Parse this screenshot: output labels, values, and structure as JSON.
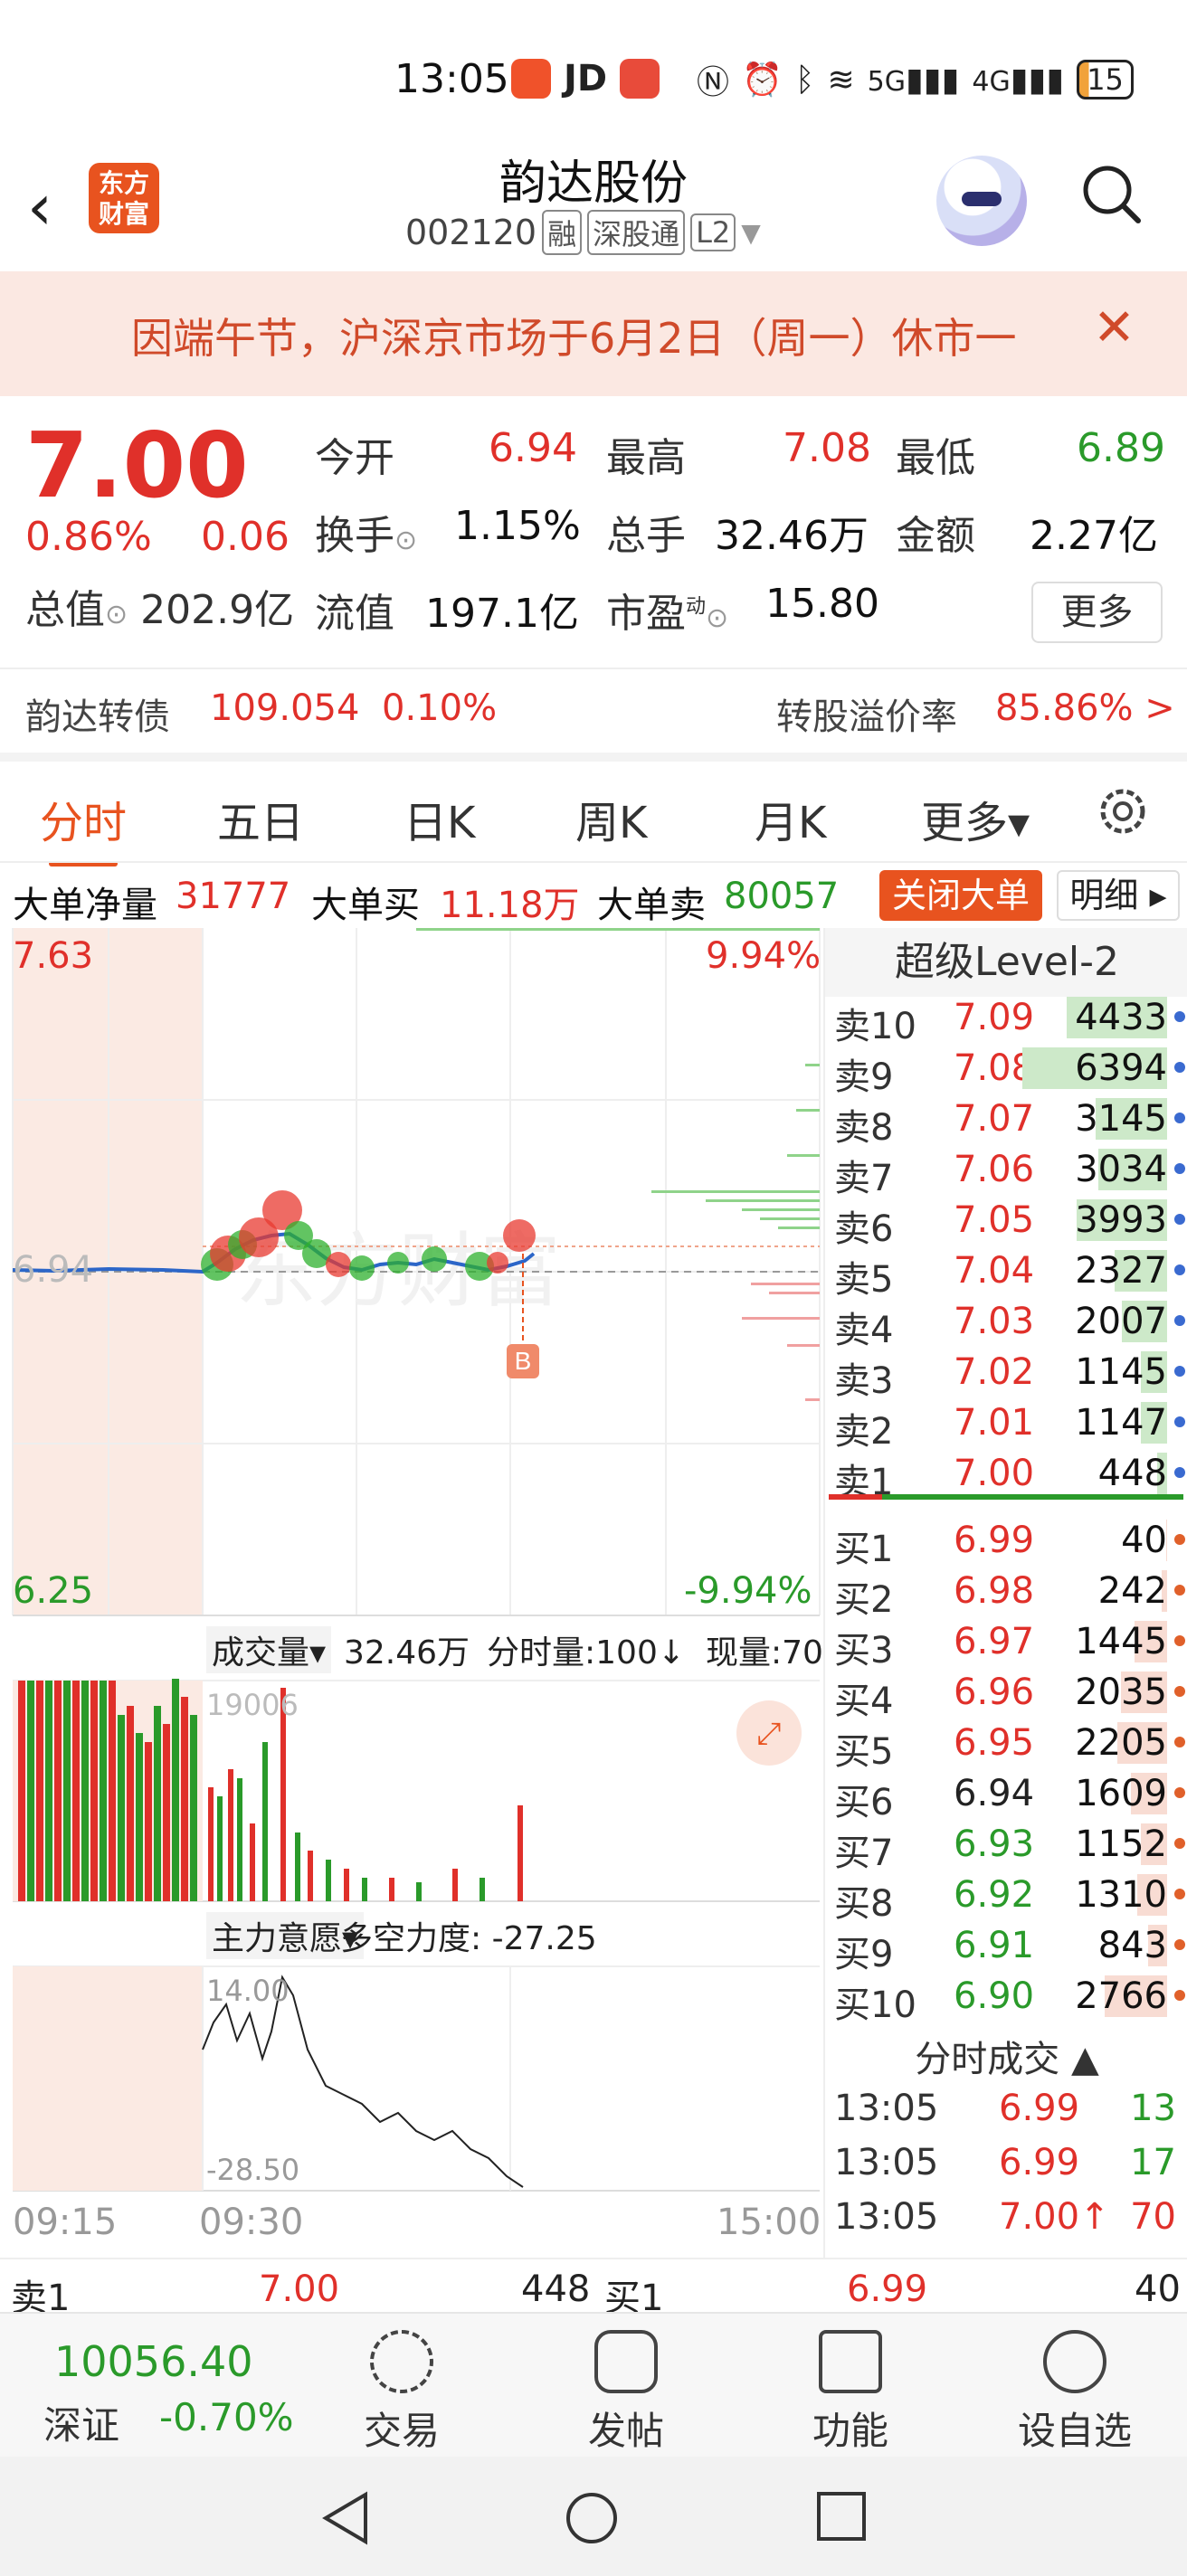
{
  "status_bar": {
    "time": "13:05",
    "jd": "JD",
    "signal_5g": "5G",
    "signal_4g": "4G",
    "battery": "15"
  },
  "header": {
    "logo_text_line1": "东方",
    "logo_text_line2": "财富",
    "stock_name": "韵达股份",
    "stock_code": "002120",
    "tag_margin": "融",
    "tag_connect": "深股通",
    "tag_level": "L2"
  },
  "banner": {
    "text": "因端午节，沪深京市场于6月2日（周一）休市一"
  },
  "quote": {
    "price": "7.00",
    "change_pct": "0.86%",
    "change_amt": "0.06",
    "open_label": "今开",
    "open_value": "6.94",
    "high_label": "最高",
    "high_value": "7.08",
    "low_label": "最低",
    "low_value": "6.89",
    "turnover_label": "换手",
    "turnover_value": "1.15%",
    "volume_label": "总手",
    "volume_value": "32.46万",
    "amount_label": "金额",
    "amount_value": "2.27亿",
    "total_cap_label": "总值",
    "total_cap_value": "202.9亿",
    "float_cap_label": "流值",
    "float_cap_value": "197.1亿",
    "pe_label": "市盈",
    "pe_super": "动",
    "pe_value": "15.80",
    "more_label": "更多"
  },
  "bond": {
    "label": "韵达转债",
    "price": "109.054",
    "change": "0.10%",
    "premium_label": "转股溢价率",
    "premium_value": "85.86% >"
  },
  "tabs": [
    "分时",
    "五日",
    "日K",
    "周K",
    "月K",
    "更多▾"
  ],
  "big_order": {
    "net_label": "大单净量",
    "net_value": "31777",
    "buy_label": "大单买",
    "buy_value": "11.18万",
    "sell_label": "大单卖",
    "sell_value": "80057",
    "close_button": "关闭大单",
    "detail_button": "明细 ▸"
  },
  "chart": {
    "upper_price": "7.63",
    "upper_pct": "9.94%",
    "lower_price": "6.25",
    "lower_pct": "-9.94%",
    "ref_price": "6.94",
    "watermark": "东方财富",
    "marker": "B",
    "volume_label": "成交量▾",
    "volume_total": "32.46万",
    "tick_volume": "分时量:100↓",
    "current_volume": "现量:70",
    "volume_max": "19006",
    "indicator_label": "主力意愿▾",
    "indicator_value": "多空力度: -27.25",
    "indicator_high": "14.00",
    "indicator_low": "-28.50",
    "time_start": "09:15",
    "time_open": "09:30",
    "time_end": "15:00"
  },
  "orderbook": {
    "header": "超级Level-2",
    "asks": [
      {
        "name": "卖10",
        "price": "7.09",
        "qty": "4433"
      },
      {
        "name": "卖9",
        "price": "7.08",
        "qty": "6394"
      },
      {
        "name": "卖8",
        "price": "7.07",
        "qty": "3145"
      },
      {
        "name": "卖7",
        "price": "7.06",
        "qty": "3034"
      },
      {
        "name": "卖6",
        "price": "7.05",
        "qty": "3993"
      },
      {
        "name": "卖5",
        "price": "7.04",
        "qty": "2327"
      },
      {
        "name": "卖4",
        "price": "7.03",
        "qty": "2007"
      },
      {
        "name": "卖3",
        "price": "7.02",
        "qty": "1145"
      },
      {
        "name": "卖2",
        "price": "7.01",
        "qty": "1147"
      },
      {
        "name": "卖1",
        "price": "7.00",
        "qty": "448"
      }
    ],
    "bids": [
      {
        "name": "买1",
        "price": "6.99",
        "qty": "40"
      },
      {
        "name": "买2",
        "price": "6.98",
        "qty": "242"
      },
      {
        "name": "买3",
        "price": "6.97",
        "qty": "1445"
      },
      {
        "name": "买4",
        "price": "6.96",
        "qty": "2035"
      },
      {
        "name": "买5",
        "price": "6.95",
        "qty": "2205"
      },
      {
        "name": "买6",
        "price": "6.94",
        "qty": "1609"
      },
      {
        "name": "买7",
        "price": "6.93",
        "qty": "1152"
      },
      {
        "name": "买8",
        "price": "6.92",
        "qty": "1310"
      },
      {
        "name": "买9",
        "price": "6.91",
        "qty": "843"
      },
      {
        "name": "买10",
        "price": "6.90",
        "qty": "2766"
      }
    ],
    "trades_header": "分时成交 ▲",
    "trades": [
      {
        "time": "13:05",
        "price": "6.99",
        "vol": "13"
      },
      {
        "time": "13:05",
        "price": "6.99",
        "vol": "17"
      },
      {
        "time": "13:05",
        "price": "7.00↑",
        "vol": "70"
      }
    ]
  },
  "strip": {
    "ask_label": "卖1",
    "ask_price": "7.00",
    "ask_qty": "448",
    "bid_label": "买1",
    "bid_price": "6.99",
    "bid_qty": "40"
  },
  "bottom_nav": {
    "index_value": "10056.40",
    "index_name": "深证",
    "index_change": "-0.70%",
    "items": [
      "交易",
      "发帖",
      "功能",
      "设自选"
    ]
  }
}
